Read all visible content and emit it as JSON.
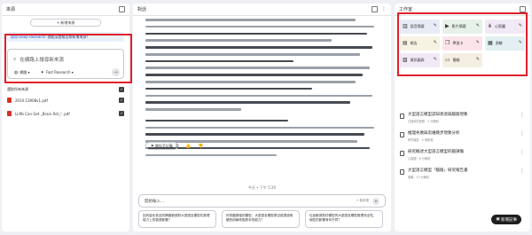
{
  "left": {
    "title": "來源",
    "add_source": "+ 新增來源",
    "deep_research": {
      "badge": "試用 Deep Research",
      "text": "就能深度報告和新增來源！"
    },
    "search": {
      "placeholder": "在網路上搜尋新來源",
      "web_chip": "網路",
      "mode_chip": "Fast Research"
    },
    "select_all": "選取所有來源",
    "files": [
      {
        "name": "2010.13908v1.pdf"
      },
      {
        "name": "LLMs Can Get _Brain Rot_! .pdf"
      }
    ]
  },
  "middle": {
    "title": "對話",
    "save_note": "儲存至記事",
    "reactions": "⧉ 👍 👎",
    "footnote": "今天 • 下午 5:20",
    "chat_placeholder": "開始輸入…",
    "source_count": "2 個來源",
    "suggestions": [
      "如何量化低品質網路數據對大型語言模型在推理能力上的衰退影響？",
      "針對腦損傷的模型，大型語言模型是否能透過後續的訓練恢復原本的能力？",
      "垃圾數據對於模型的大型語言模型推理安全性，個性的影響有何不同？"
    ]
  },
  "right": {
    "title": "工作室",
    "tiles": [
      {
        "label": "語音摘要",
        "icon": "▥",
        "color": "#e8ecf6"
      },
      {
        "label": "影片摘要",
        "icon": "▶",
        "color": "#e6f1e8"
      },
      {
        "label": "心智圖",
        "icon": "⋔",
        "color": "#f1e9f5"
      },
      {
        "label": "報告",
        "icon": "▤",
        "color": "#f6f3e3"
      },
      {
        "label": "學習卡",
        "icon": "❐",
        "color": "#fbe5ea"
      },
      {
        "label": "測驗",
        "icon": "▦",
        "color": "#e3f0f3"
      },
      {
        "label": "資訊圖表",
        "icon": "▧",
        "color": "#f1e9f5"
      },
      {
        "label": "簡報",
        "icon": "▭",
        "color": "#f4efe2"
      }
    ],
    "notes": [
      {
        "title": "大型語言模型認知衰退與腦腐現象",
        "meta": "已儲存的回應 · 4 分鐘前"
      },
      {
        "title": "推理失敗與思維跳步現象分析",
        "meta": "研究報告 · 5 個來源"
      },
      {
        "title": "研究概述大型語言模型的腦損傷",
        "meta": "心智圖 · 6 分鐘前"
      },
      {
        "title": "大型語言模型「腦腐」研究報告書",
        "meta": "簡報 · 10 分鐘前"
      }
    ],
    "add_note": "新增記事"
  },
  "colors": {
    "highlight": "#e0202a",
    "accent": "#1a56d6"
  }
}
